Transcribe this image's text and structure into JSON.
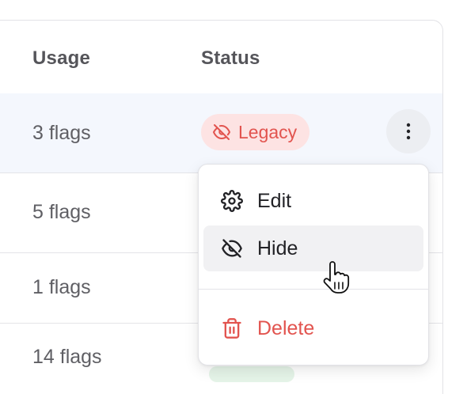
{
  "table": {
    "columns": {
      "usage": "Usage",
      "status": "Status"
    },
    "rows": [
      {
        "usage": "3 flags",
        "status": "Legacy"
      },
      {
        "usage": "5 flags"
      },
      {
        "usage": "1 flags"
      },
      {
        "usage": "14 flags"
      }
    ]
  },
  "menu": {
    "items": [
      {
        "label": "Edit",
        "icon": "gear-icon"
      },
      {
        "label": "Hide",
        "icon": "eye-off-icon"
      },
      {
        "label": "Delete",
        "icon": "trash-icon"
      }
    ]
  },
  "colors": {
    "danger": "#e2544f",
    "danger_bg": "#fde3e3",
    "row_highlight": "#f4f7fd",
    "hover_bg": "#f1f1f3"
  }
}
